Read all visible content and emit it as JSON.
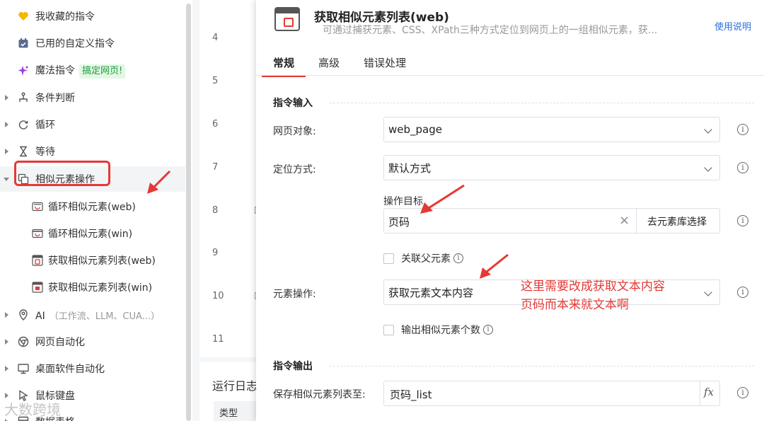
{
  "sidebar": {
    "items": [
      {
        "label": "我收藏的指令",
        "icon": "heart-icon"
      },
      {
        "label": "已用的自定义指令",
        "icon": "calendar-icon"
      },
      {
        "label": "魔法指令",
        "icon": "sparkle-icon",
        "badge": "搞定网页!"
      },
      {
        "label": "条件判断",
        "icon": "branch-icon"
      },
      {
        "label": "循环",
        "icon": "loop-icon"
      },
      {
        "label": "等待",
        "icon": "hourglass-icon"
      },
      {
        "label": "相似元素操作",
        "icon": "similar-elements-icon"
      },
      {
        "label": "循环相似元素(web)",
        "icon": "web-element-icon"
      },
      {
        "label": "循环相似元素(win)",
        "icon": "win-element-icon"
      },
      {
        "label": "获取相似元素列表(web)",
        "icon": "web-list-icon"
      },
      {
        "label": "获取相似元素列表(win)",
        "icon": "win-list-icon"
      },
      {
        "label": "AI",
        "icon": "ai-icon",
        "hint": "（工作流、LLM、CUA...）"
      },
      {
        "label": "网页自动化",
        "icon": "browser-icon"
      },
      {
        "label": "桌面软件自动化",
        "icon": "desktop-icon"
      },
      {
        "label": "鼠标键盘",
        "icon": "mouse-icon"
      },
      {
        "label": "数据表格",
        "icon": "table-icon"
      }
    ]
  },
  "editor": {
    "line_numbers": [
      "4",
      "5",
      "6",
      "7",
      "8",
      "9",
      "10",
      "11"
    ],
    "log_title": "运行日志",
    "log_column": "类型"
  },
  "dialog": {
    "title": "获取相似元素列表(web)",
    "description": "可通过捕获元素、CSS、XPath三种方式定位到网页上的一组相似元素，获...",
    "help_link": "使用说明",
    "tabs": [
      "常规",
      "高级",
      "错误处理"
    ],
    "input_section": "指令输入",
    "output_section": "指令输出",
    "fields": {
      "web_object_label": "网页对象:",
      "web_object_value": "web_page",
      "locate_label": "定位方式:",
      "locate_value": "默认方式",
      "target_label": "操作目标",
      "target_value": "页码",
      "target_button": "去元素库选择",
      "related_parent": "关联父元素",
      "element_op_label": "元素操作:",
      "element_op_value": "获取元素文本内容",
      "output_count": "输出相似元素个数",
      "save_label": "保存相似元素列表至:",
      "save_value": "页码_list",
      "fx_symbol": "fx",
      "info_symbol": "i",
      "clear_symbol": "×"
    }
  },
  "annotation": {
    "line1": "这里需要改成获取文本内容",
    "line2": "页码而本来就文本啊"
  },
  "watermark": "大数跨境",
  "colors": {
    "accent": "#e53935",
    "link": "#2a6fdb",
    "badge_bg": "#e3f7e5",
    "badge_text": "#1f9d3a"
  }
}
